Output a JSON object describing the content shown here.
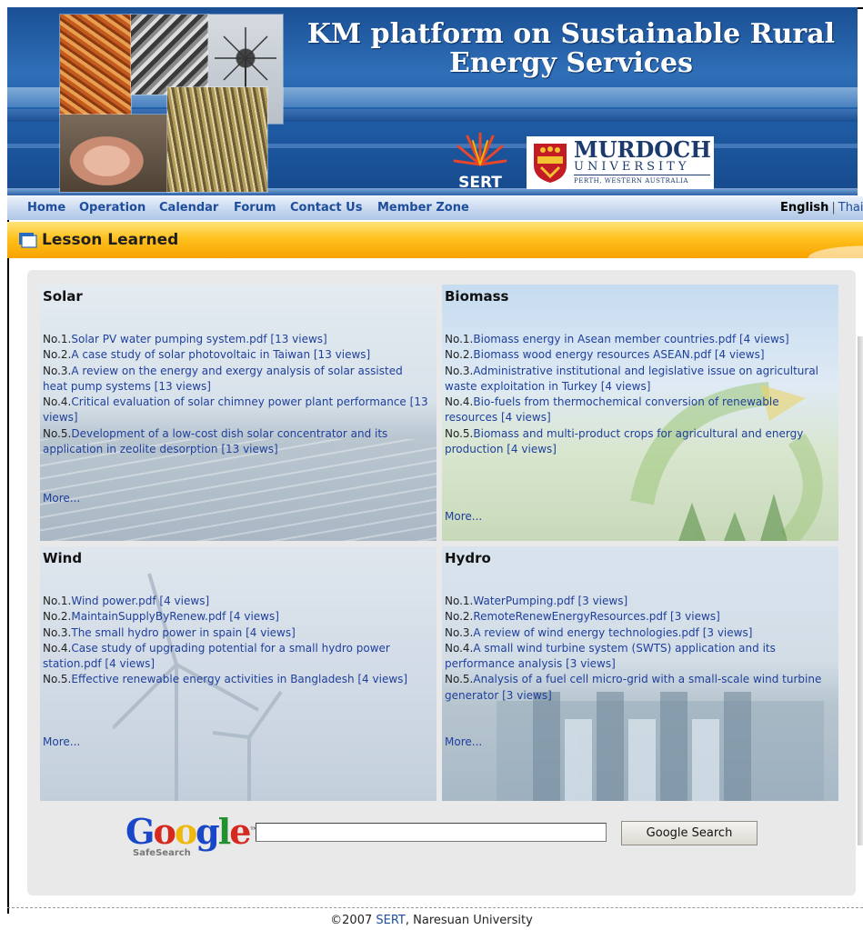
{
  "banner": {
    "title_line1": "KM platform on Sustainable Rural",
    "title_line2": "Energy Services",
    "sert_label": "SERT",
    "murdoch_name": "MURDOCH",
    "murdoch_sub": "UNIVERSITY",
    "murdoch_location": "PERTH, WESTERN AUSTRALIA"
  },
  "nav": {
    "items": [
      "Home",
      "Operation",
      "Calendar",
      "Forum",
      "Contact Us",
      "Member Zone"
    ],
    "lang_english": "English",
    "lang_sep": "|",
    "lang_thai": "Thai"
  },
  "section": {
    "title": "Lesson Learned"
  },
  "categories": [
    {
      "name": "Solar",
      "more": "More...",
      "items": [
        {
          "no": "No.1.",
          "title": "Solar PV water pumping system.pdf",
          "views": " [13 views]"
        },
        {
          "no": "No.2.",
          "title": "A case study of solar photovoltaic in Taiwan",
          "views": " [13 views]"
        },
        {
          "no": "No.3.",
          "title": "A review on the energy and exergy analysis of solar assisted heat pump systems",
          "views": " [13 views]"
        },
        {
          "no": "No.4.",
          "title": "Critical evaluation of solar chimney power plant performance",
          "views": " [13 views]"
        },
        {
          "no": "No.5.",
          "title": "Development of a low-cost dish solar concentrator and its application in zeolite desorption",
          "views": " [13 views]"
        }
      ]
    },
    {
      "name": "Biomass",
      "more": "More...",
      "items": [
        {
          "no": "No.1.",
          "title": "Biomass energy in Asean member countries.pdf",
          "views": " [4 views]"
        },
        {
          "no": "No.2.",
          "title": "Biomass wood energy resources ASEAN.pdf",
          "views": " [4 views]"
        },
        {
          "no": "No.3.",
          "title": "Administrative institutional and legislative issue on agricultural waste exploitation in Turkey",
          "views": " [4 views]"
        },
        {
          "no": "No.4.",
          "title": "Bio-fuels from thermochemical conversion of renewable resources",
          "views": " [4 views]"
        },
        {
          "no": "No.5.",
          "title": "Biomass and multi-product crops for agricultural and energy production",
          "views": " [4 views]"
        }
      ]
    },
    {
      "name": "Wind",
      "more": "More...",
      "items": [
        {
          "no": "No.1.",
          "title": "Wind power.pdf",
          "views": " [4 views]"
        },
        {
          "no": "No.2.",
          "title": "MaintainSupplyByRenew.pdf",
          "views": " [4 views]"
        },
        {
          "no": "No.3.",
          "title": "The small hydro power in spain",
          "views": " [4 views]"
        },
        {
          "no": "No.4.",
          "title": "Case study of upgrading potential for a small hydro power station.pdf",
          "views": " [4 views]"
        },
        {
          "no": "No.5.",
          "title": "Effective renewable energy activities in Bangladesh",
          "views": " [4 views]"
        }
      ]
    },
    {
      "name": "Hydro",
      "more": "More...",
      "items": [
        {
          "no": "No.1.",
          "title": "WaterPumping.pdf",
          "views": " [3 views]"
        },
        {
          "no": "No.2.",
          "title": "RemoteRenewEnergyResources.pdf",
          "views": " [3 views]"
        },
        {
          "no": "No.3.",
          "title": "A review of wind energy technologies.pdf",
          "views": " [3 views]"
        },
        {
          "no": "No.4.",
          "title": "A small wind turbine system (SWTS) application and its performance analysis",
          "views": " [3 views]"
        },
        {
          "no": "No.5.",
          "title": "Analysis of a fuel cell micro-grid with a small-scale wind turbine generator",
          "views": " [3 views]"
        }
      ]
    }
  ],
  "search": {
    "logo_letters": [
      "G",
      "o",
      "o",
      "g",
      "l",
      "e"
    ],
    "logo_tm": "™",
    "safesearch": "SafeSearch",
    "input_value": "",
    "button_label": "Google Search"
  },
  "footer": {
    "copyright": "©2007 ",
    "link": "SERT",
    "suffix": ", Naresuan University"
  },
  "colors": {
    "nav_link": "#1e4d9b",
    "item_link": "#1f3f9c",
    "section_bar": "#ffc21f",
    "google_blue": "#1a47c8",
    "google_red": "#d6291e",
    "google_yellow": "#efb80d",
    "google_green": "#23902f"
  }
}
